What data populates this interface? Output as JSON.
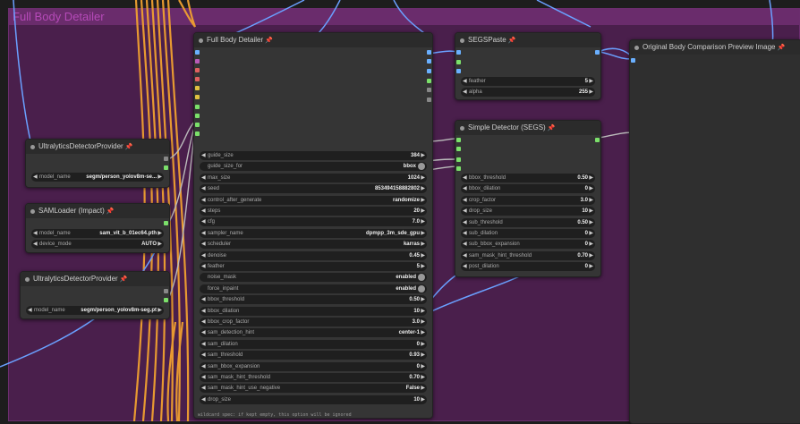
{
  "group": {
    "title": "Full Body Detailer"
  },
  "nodes": {
    "detailer": {
      "title": "Full Body Detailer",
      "widgets": [
        {
          "label": "guide_size",
          "value": "384",
          "type": "num"
        },
        {
          "label": "guide_size_for",
          "value": "bbox",
          "type": "toggle"
        },
        {
          "label": "max_size",
          "value": "1024",
          "type": "num"
        },
        {
          "label": "seed",
          "value": "853494158882802",
          "type": "num"
        },
        {
          "label": "control_after_generate",
          "value": "randomize",
          "type": "num"
        },
        {
          "label": "steps",
          "value": "20",
          "type": "num"
        },
        {
          "label": "cfg",
          "value": "7.0",
          "type": "num"
        },
        {
          "label": "sampler_name",
          "value": "dpmpp_3m_sde_gpu",
          "type": "num"
        },
        {
          "label": "scheduler",
          "value": "karras",
          "type": "num"
        },
        {
          "label": "denoise",
          "value": "0.45",
          "type": "num"
        },
        {
          "label": "feather",
          "value": "5",
          "type": "num"
        },
        {
          "label": "noise_mask",
          "value": "enabled",
          "type": "toggle"
        },
        {
          "label": "force_inpaint",
          "value": "enabled",
          "type": "toggle"
        },
        {
          "label": "bbox_threshold",
          "value": "0.50",
          "type": "num"
        },
        {
          "label": "bbox_dilation",
          "value": "10",
          "type": "num"
        },
        {
          "label": "bbox_crop_factor",
          "value": "3.0",
          "type": "num"
        },
        {
          "label": "sam_detection_hint",
          "value": "center-1",
          "type": "num"
        },
        {
          "label": "sam_dilation",
          "value": "0",
          "type": "num"
        },
        {
          "label": "sam_threshold",
          "value": "0.93",
          "type": "num"
        },
        {
          "label": "sam_bbox_expansion",
          "value": "0",
          "type": "num"
        },
        {
          "label": "sam_mask_hint_threshold",
          "value": "0.70",
          "type": "num"
        },
        {
          "label": "sam_mask_hint_use_negative",
          "value": "False",
          "type": "num"
        },
        {
          "label": "drop_size",
          "value": "10",
          "type": "num"
        }
      ],
      "footer": "wildcard spec: if kept empty, this option will be ignored"
    },
    "segspaste": {
      "title": "SEGSPaste",
      "widgets": [
        {
          "label": "feather",
          "value": "5",
          "type": "num"
        },
        {
          "label": "alpha",
          "value": "255",
          "type": "num"
        }
      ]
    },
    "simple_detector": {
      "title": "Simple Detector (SEGS)",
      "widgets": [
        {
          "label": "bbox_threshold",
          "value": "0.50",
          "type": "num"
        },
        {
          "label": "bbox_dilation",
          "value": "0",
          "type": "num"
        },
        {
          "label": "crop_factor",
          "value": "3.0",
          "type": "num"
        },
        {
          "label": "drop_size",
          "value": "10",
          "type": "num"
        },
        {
          "label": "sub_threshold",
          "value": "0.50",
          "type": "num"
        },
        {
          "label": "sub_dilation",
          "value": "0",
          "type": "num"
        },
        {
          "label": "sub_bbox_expansion",
          "value": "0",
          "type": "num"
        },
        {
          "label": "sam_mask_hint_threshold",
          "value": "0.70",
          "type": "num"
        },
        {
          "label": "post_dilation",
          "value": "0",
          "type": "num"
        }
      ]
    },
    "ultra1": {
      "title": "UltralyticsDetectorProvider",
      "widgets": [
        {
          "label": "model_name",
          "value": "segm/person_yolov8m-se...",
          "type": "num"
        }
      ]
    },
    "samloader": {
      "title": "SAMLoader (Impact)",
      "widgets": [
        {
          "label": "model_name",
          "value": "sam_vit_b_01ec64.pth",
          "type": "num"
        },
        {
          "label": "device_mode",
          "value": "AUTO",
          "type": "num"
        }
      ]
    },
    "ultra2": {
      "title": "UltralyticsDetectorProvider",
      "widgets": [
        {
          "label": "model_name",
          "value": "segm/person_yolov8m-seg.pt",
          "type": "num"
        }
      ]
    },
    "preview": {
      "title": "Original Body Comparison Preview Image"
    }
  },
  "colors": {
    "group_bg": "#4a1f4c",
    "group_title": "#6a2c6c",
    "wire_orange": "#f0a030",
    "wire_blue": "#6aa0ff",
    "wire_grey": "#bbbbbb",
    "socket_green": "#7be06a",
    "socket_blue": "#6ab0ff"
  }
}
